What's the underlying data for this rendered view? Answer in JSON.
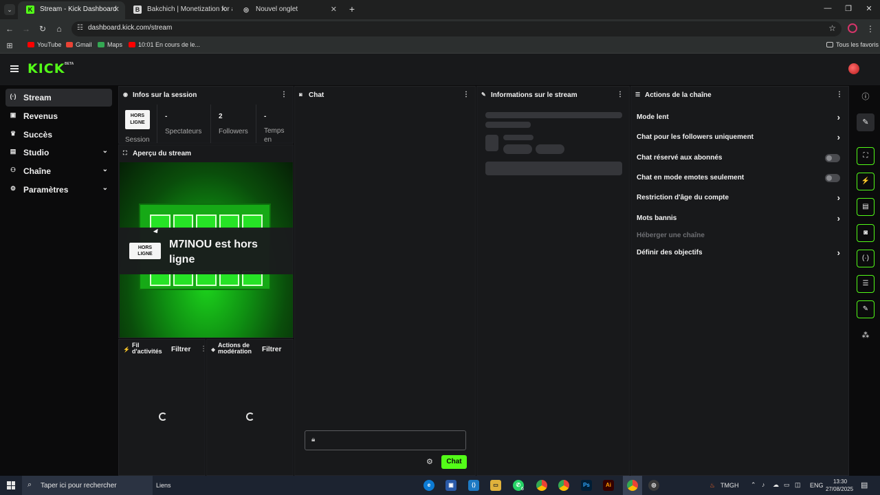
{
  "browser": {
    "tabs": [
      {
        "title": "Stream - Kick Dashboard",
        "favicon": "K",
        "color": "#53fc18",
        "active": true
      },
      {
        "title": "Bakchich | Monetization for afr",
        "favicon": "B",
        "color": "#d8d8d8",
        "active": false
      },
      {
        "title": "Nouvel onglet",
        "favicon": "◎",
        "color": "#d8d8d8",
        "active": false
      }
    ],
    "new_tab": "+",
    "url": "dashboard.kick.com/stream",
    "bookmarks": [
      {
        "label": "YouTube",
        "color": "#ff0000"
      },
      {
        "label": "Gmail",
        "color": "#ea4335"
      },
      {
        "label": "Maps",
        "color": "#34a853"
      },
      {
        "label": "10:01 En cours de le...",
        "color": "#ff0000"
      }
    ],
    "all_bookmarks": "Tous les favoris"
  },
  "header": {
    "logo": "KICK",
    "logo_badge": "BETA"
  },
  "sidenav": {
    "items": [
      {
        "label": "Stream",
        "icon": "broadcast-icon",
        "glyph": "(·)",
        "active": true,
        "chevron": false
      },
      {
        "label": "Revenus",
        "icon": "wallet-icon",
        "glyph": "▣",
        "active": false,
        "chevron": false
      },
      {
        "label": "Succès",
        "icon": "trophy-icon",
        "glyph": "♛",
        "active": false,
        "chevron": false
      },
      {
        "label": "Studio",
        "icon": "studio-icon",
        "glyph": "▤",
        "active": false,
        "chevron": true
      },
      {
        "label": "Chaîne",
        "icon": "channel-icon",
        "glyph": "⚇",
        "active": false,
        "chevron": true
      },
      {
        "label": "Paramètres",
        "icon": "gear-icon",
        "glyph": "⚙",
        "active": false,
        "chevron": true
      }
    ]
  },
  "session": {
    "title": "Infos sur la session",
    "badge": [
      "HORS",
      "LIGNE"
    ],
    "badge_caption": "Session",
    "stats": [
      {
        "value": "-",
        "label": "Spectateurs"
      },
      {
        "value": "2",
        "label": "Followers"
      },
      {
        "value": "-",
        "label": "Temps en"
      }
    ]
  },
  "preview": {
    "title": "Aperçu du stream",
    "badge": [
      "HORS",
      "LIGNE"
    ],
    "message": "M7INOU est hors ligne"
  },
  "activity": {
    "title": "Fil d'activités",
    "filter": "Filtrer"
  },
  "moderation": {
    "title": "Actions de modération",
    "filter": "Filtrer"
  },
  "chat": {
    "title": "Chat",
    "send_label": "Chat"
  },
  "stream_info": {
    "title": "Informations sur le stream"
  },
  "channel_actions": {
    "title": "Actions de la chaîne",
    "items": [
      {
        "label": "Mode lent",
        "control": "arrow"
      },
      {
        "label": "Chat pour les followers uniquement",
        "control": "arrow"
      },
      {
        "label": "Chat réservé aux abonnés",
        "control": "toggle"
      },
      {
        "label": "Chat en mode emotes seulement",
        "control": "toggle"
      },
      {
        "label": "Restriction d'âge du compte",
        "control": "arrow"
      },
      {
        "label": "Mots bannis",
        "control": "arrow"
      },
      {
        "label": "Héberger une chaîne",
        "control": "disabled"
      },
      {
        "label": "Définir des objectifs",
        "control": "arrow"
      }
    ]
  },
  "taskbar": {
    "search_placeholder": "Taper ici pour rechercher",
    "links": "Liens",
    "weather": "TMGH",
    "lang": "ENG",
    "time": "13:30",
    "date": "27/08/2025",
    "whatsapp_badge": "6"
  },
  "colors": {
    "accent": "#53fc18",
    "panel": "#18191b",
    "background": "#0b0b0c"
  }
}
